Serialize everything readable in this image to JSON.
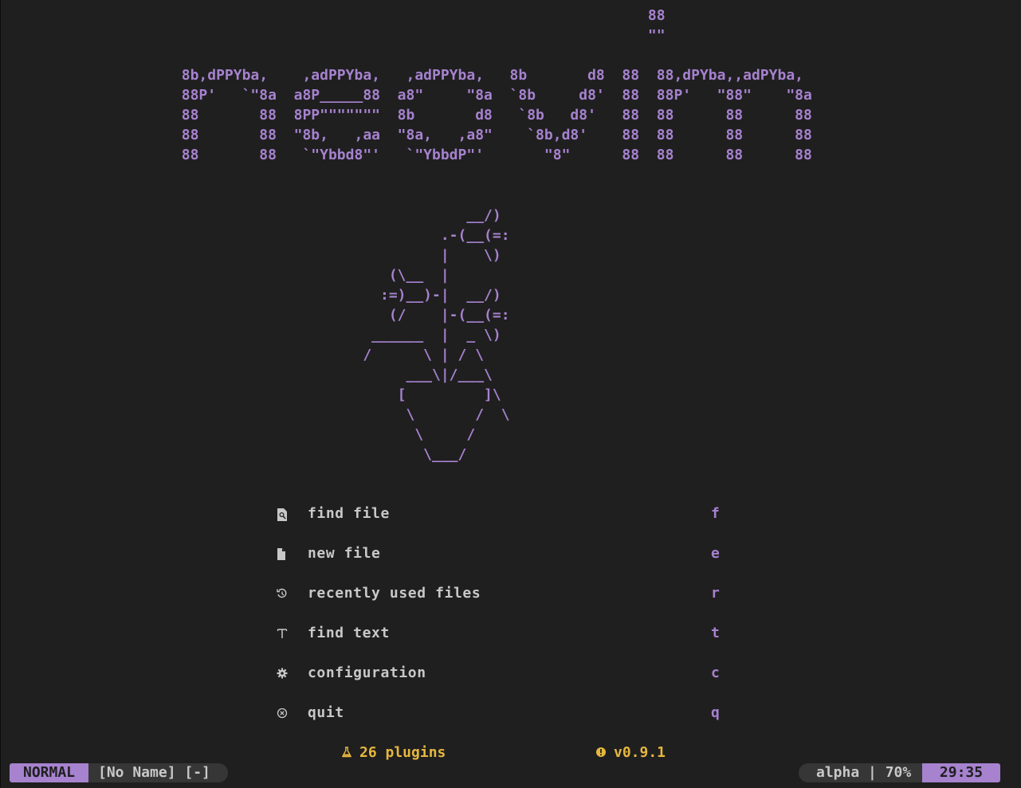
{
  "dashboard": {
    "header_art": "                                                                          88\n                                                                          \"\"\n\n                    8b,dPPYba,    ,adPPYba,   ,adPPYba,   8b       d8  88  88,dPYba,,adPYba,\n                    88P'   `\"8a  a8P_____88  a8\"     \"8a  `8b     d8'  88  88P'   \"88\"    \"8a\n                    88       88  8PP\"\"\"\"\"\"\"  8b       d8   `8b   d8'   88  88      88      88\n                    88       88  \"8b,   ,aa  \"8a,   ,a8\"    `8b,d8'    88  88      88      88\n                    88       88   `\"Ybbd8\"'   `\"YbbdP\"'       \"8\"      88  88      88      88",
    "flower_art": "                                                     __/)\n                                                  .-(__(=:\n                                                  |    \\)\n                                            (\\__  |\n                                           :=)__)-|  __/)\n                                            (/    |-(__(=:\n                                          ______  |  _ \\)\n                                         /      \\ | / \\\n                                              ___\\|/___\\\n                                             [         ]\\\n                                              \\       /  \\\n                                               \\     /\n                                                \\___/"
  },
  "menu": {
    "items": [
      {
        "label": "find file",
        "key": "f",
        "icon": "file-search-icon"
      },
      {
        "label": "new file",
        "key": "e",
        "icon": "file-icon"
      },
      {
        "label": "recently used files",
        "key": "r",
        "icon": "history-icon"
      },
      {
        "label": "find text",
        "key": "t",
        "icon": "text-icon"
      },
      {
        "label": "configuration",
        "key": "c",
        "icon": "gear-icon"
      },
      {
        "label": "quit",
        "key": "q",
        "icon": "quit-icon"
      }
    ]
  },
  "footer": {
    "plugins": "26 plugins",
    "plugins_icon": "flask-icon",
    "version": "v0.9.1",
    "version_icon": "info-circle-icon"
  },
  "statusline": {
    "mode": "NORMAL",
    "filename": "[No Name] [-]",
    "filetype_percent": "alpha | 70%",
    "position": "29:35"
  },
  "colors": {
    "background": "#1f1f1f",
    "accent": "#a682cf",
    "text": "#c8c8c8",
    "footer": "#e6b73f",
    "statusline_bg": "#363636"
  }
}
